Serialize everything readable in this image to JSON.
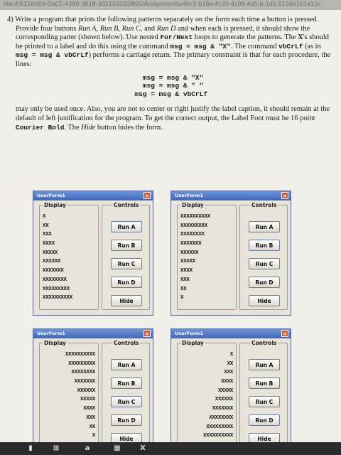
{
  "top_strip": "ntent/6118069-DaCE-4380-3018-3021022ZD80S/Assignments/4bc5-b18a-4cd5-4c08-4d5-b-1d5-0150e1b1e15c",
  "question": {
    "number": "4)",
    "para1": [
      {
        "t": "Write a program that prints the following patterns separately on the form each time a button is pressed. Provide four buttons "
      },
      {
        "t": "Run A, Run B, Run C,",
        "i": true
      },
      {
        "t": " and "
      },
      {
        "t": "Run D",
        "i": true
      },
      {
        "t": " and when each is pressed, it should show the corresponding patter (shown below). Use nested "
      },
      {
        "t": "For/Next",
        "c": true
      },
      {
        "t": " loops to generate the patterns. The "
      },
      {
        "t": "X",
        "b": true
      },
      {
        "t": "'s should be printed to a label and do this using the command "
      },
      {
        "t": "msg = msg & \"X\"",
        "c": true
      },
      {
        "t": ". The command "
      },
      {
        "t": "vbCrLf",
        "c": true
      },
      {
        "t": " (as in "
      },
      {
        "t": "msg = msg & vbCrLf",
        "c": true
      },
      {
        "t": ") performs a carriage return. The primary constraint is that for each procedure, the lines:"
      }
    ],
    "code_lines": [
      "    msg = msg & \"X\"",
      "    msg = msg & \" \"",
      "  msg = msg & vbCrLf"
    ],
    "para2": [
      {
        "t": "may only be used once. Also, you are not to center or right justify the label caption, it should remain at the default of left justification for the program. To get the correct output, the Label Font must be 16 point "
      },
      {
        "t": "Courier Bold",
        "c": true
      },
      {
        "t": ". The "
      },
      {
        "t": "Hide",
        "i": true
      },
      {
        "t": " button hides the form."
      }
    ]
  },
  "forms": [
    {
      "title": "UserForm1",
      "display_label": "Display",
      "controls_label": "Controls",
      "align": "left",
      "active": "Run A",
      "rows": [
        "X",
        "XX",
        "XXX",
        "XXXX",
        "XXXXX",
        "XXXXXX",
        "XXXXXXX",
        "XXXXXXXX",
        "XXXXXXXXX",
        "XXXXXXXXXX"
      ]
    },
    {
      "title": "UserForm1",
      "display_label": "Display",
      "controls_label": "Controls",
      "align": "left",
      "active": "Run B",
      "rows": [
        "XXXXXXXXXX",
        "XXXXXXXXX",
        "XXXXXXXX",
        "XXXXXXX",
        "XXXXXX",
        "XXXXX",
        "XXXX",
        "XXX",
        "XX",
        "X"
      ]
    },
    {
      "title": "UserForm1",
      "display_label": "Display",
      "controls_label": "Controls",
      "align": "right",
      "active": "Run C",
      "rows": [
        "XXXXXXXXXX",
        "XXXXXXXXX",
        "XXXXXXXX",
        "XXXXXXX",
        "XXXXXX",
        "XXXXX",
        "XXXX",
        "XXX",
        "XX",
        "X"
      ]
    },
    {
      "title": "UserForm1",
      "display_label": "Display",
      "controls_label": "Controls",
      "align": "right",
      "active": "Run D",
      "rows": [
        "X",
        "XX",
        "XXX",
        "XXXX",
        "XXXXX",
        "XXXXXX",
        "XXXXXXX",
        "XXXXXXXX",
        "XXXXXXXXX",
        "XXXXXXXXXX"
      ]
    }
  ],
  "buttons": [
    "Run A",
    "Run B",
    "Run C",
    "Run D",
    "Hide"
  ],
  "taskbar": {
    "start": "windows-start-icon",
    "store": "a",
    "other": "X"
  }
}
